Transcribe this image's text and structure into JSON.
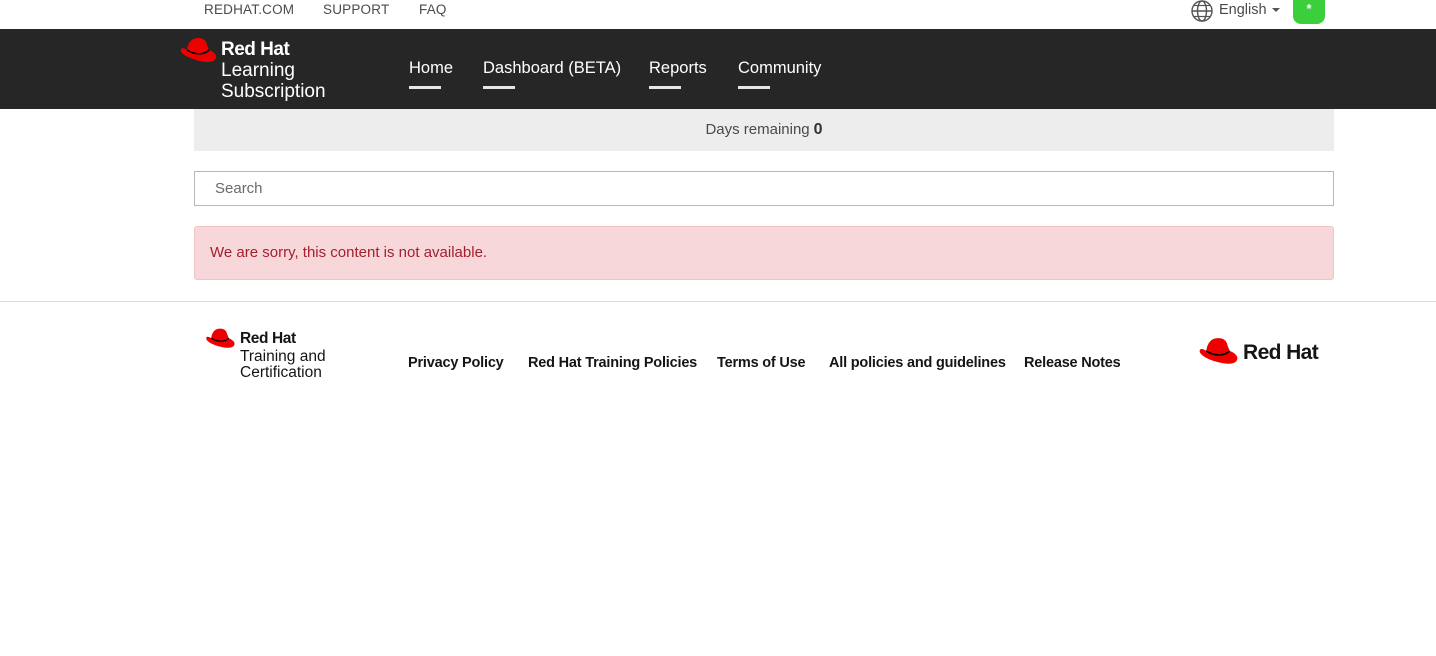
{
  "utility": {
    "links": [
      "REDHAT.COM",
      "SUPPORT",
      "FAQ"
    ],
    "language": "English",
    "avatar_text": "*"
  },
  "header": {
    "brand": {
      "name": "Red Hat",
      "line1": "Learning",
      "line2": "Subscription"
    },
    "nav": [
      "Home",
      "Dashboard (BETA)",
      "Reports",
      "Community"
    ]
  },
  "main": {
    "days_label": "Days remaining",
    "days_value": "0",
    "search_placeholder": "Search",
    "alert": "We are sorry, this content is not available."
  },
  "footer": {
    "brand": {
      "name": "Red Hat",
      "line1": "Training and",
      "line2": "Certification"
    },
    "links": [
      "Privacy Policy",
      "Red Hat Training Policies",
      "Terms of Use",
      "All policies and guidelines",
      "Release Notes"
    ],
    "logo_text": "Red Hat"
  },
  "colors": {
    "brand_red": "#ee0000",
    "header_bg": "#262626",
    "alert_bg": "#f7d7da",
    "alert_text": "#a3202f",
    "avatar": "#3ccf3c"
  },
  "icons": [
    "globe-icon",
    "caret-down-icon",
    "red-hat-logo-icon"
  ]
}
